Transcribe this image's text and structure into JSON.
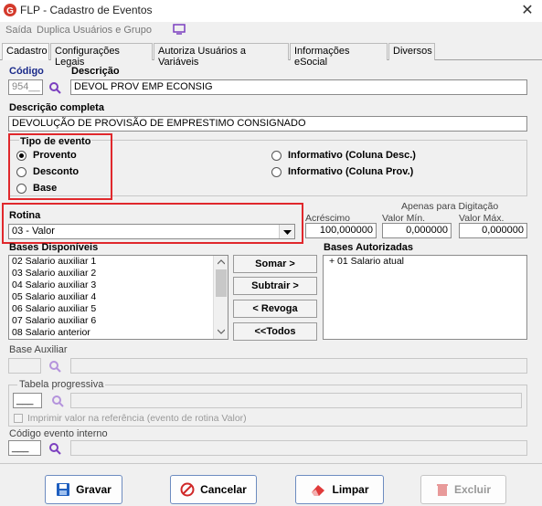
{
  "window": {
    "title": "FLP - Cadastro de Eventos",
    "close": "✕"
  },
  "menu": {
    "saida": "Saída",
    "duplica": "Duplica Usuários e Grupo"
  },
  "tabs": [
    "Cadastro",
    "Configurações Legais",
    "Autoriza Usuários a Variáveis",
    "Informações eSocial",
    "Diversos"
  ],
  "form": {
    "codigo_label": "Código",
    "codigo_value": "954__",
    "descricao_label": "Descrição",
    "descricao_value": "DEVOL PROV EMP ECONSIG",
    "descricao_completa_label": "Descrição completa",
    "descricao_completa_value": "DEVOLUÇÃO DE PROVISÃO DE EMPRESTIMO CONSIGNADO"
  },
  "tipo_evento": {
    "label": "Tipo de evento",
    "provento": "Provento",
    "desconto": "Desconto",
    "base": "Base",
    "informativo_desc": "Informativo (Coluna Desc.)",
    "informativo_prov": "Informativo (Coluna Prov.)",
    "selected": "Provento"
  },
  "rotina": {
    "label": "Rotina",
    "value": "03 - Valor"
  },
  "valores": {
    "acrescimo_label": "Acréscimo",
    "acrescimo_value": "100,000000",
    "apenas_label": "Apenas para Digitação",
    "min_label": "Valor Mín.",
    "min_value": "0,000000",
    "max_label": "Valor Máx.",
    "max_value": "0,000000"
  },
  "bases": {
    "disponiveis_label": "Bases Disponíveis",
    "disponiveis": [
      "02 Salario auxiliar 1",
      "03 Salario auxiliar 2",
      "04 Salario auxiliar 3",
      "05 Salario auxiliar 4",
      "06 Salario auxiliar 5",
      "07 Salario auxiliar 6",
      "08 Salario anterior"
    ],
    "autorizadas_label": "Bases Autorizadas",
    "autorizadas": [
      "+ 01 Salario atual"
    ],
    "somar": "Somar >",
    "subtrair": "Subtrair >",
    "revoga": "< Revoga",
    "todos": "<<Todos"
  },
  "base_auxiliar": {
    "label": "Base Auxiliar"
  },
  "tabela": {
    "label": "Tabela progressiva",
    "value": "___",
    "imprimir": "Imprimir valor na referência (evento de rotina Valor)"
  },
  "codigo_interno": {
    "label": "Código evento interno",
    "value": "___"
  },
  "actions": {
    "gravar": "Gravar",
    "cancelar": "Cancelar",
    "limpar": "Limpar",
    "excluir": "Excluir"
  },
  "colors": {
    "accent_red": "#e0282c",
    "magnifier": "#7b3fbf",
    "logo": "#d43a2c"
  }
}
